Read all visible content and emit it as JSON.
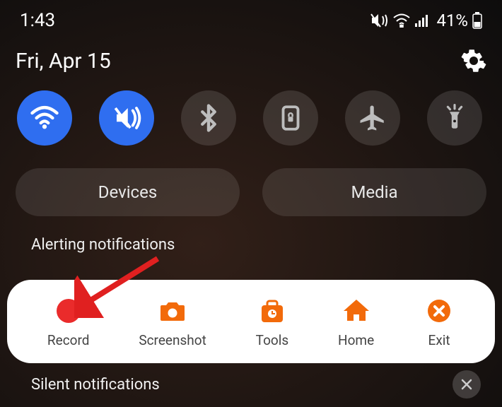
{
  "status": {
    "time": "1:43",
    "battery": "41%"
  },
  "header": {
    "date": "Fri, Apr 15"
  },
  "quick_settings": [
    {
      "id": "wifi",
      "active": true
    },
    {
      "id": "mute-vibrate",
      "active": true
    },
    {
      "id": "bluetooth",
      "active": false
    },
    {
      "id": "lock-rotation",
      "active": false
    },
    {
      "id": "airplane",
      "active": false
    },
    {
      "id": "flashlight",
      "active": false
    }
  ],
  "pills": {
    "devices": "Devices",
    "media": "Media"
  },
  "sections": {
    "alerting": "Alerting notifications",
    "silent": "Silent notifications"
  },
  "toolbar": {
    "record": "Record",
    "screenshot": "Screenshot",
    "tools": "Tools",
    "home": "Home",
    "exit": "Exit"
  },
  "colors": {
    "accent_orange": "#f26a0a",
    "record_red": "#ea2b2b",
    "active_blue": "#2f6ef0"
  }
}
